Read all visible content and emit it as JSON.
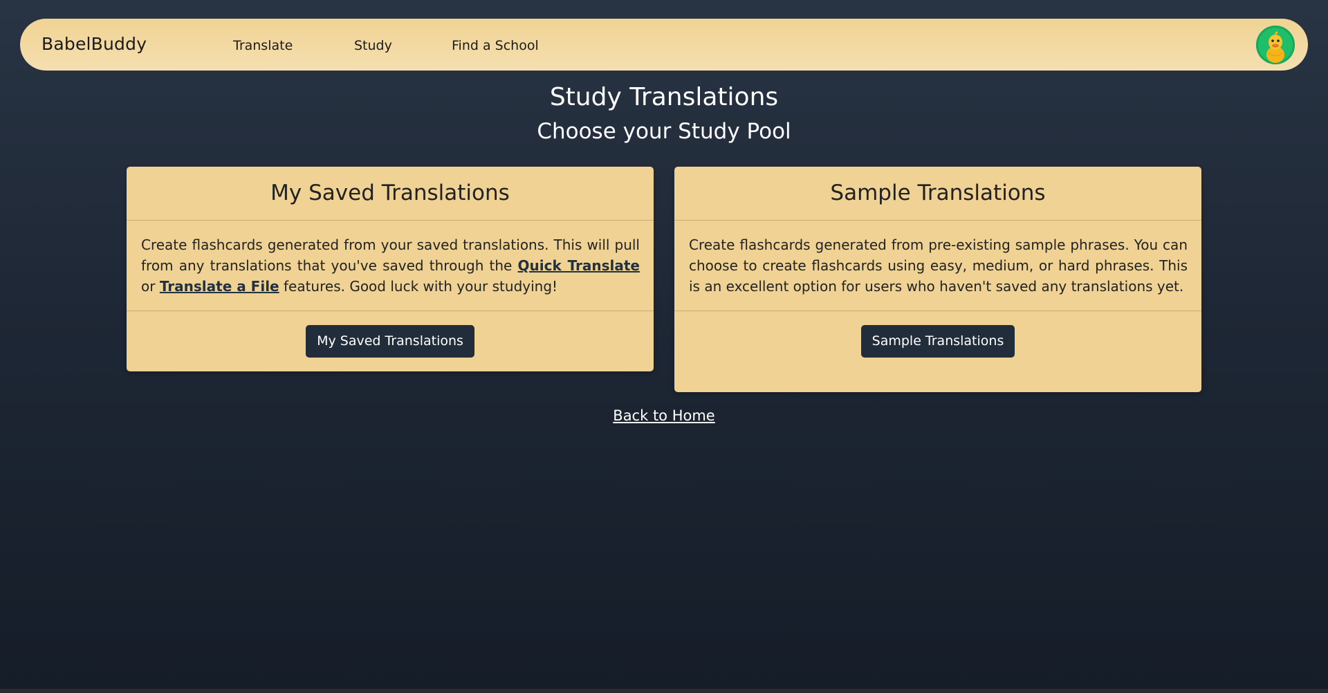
{
  "nav": {
    "brand": "BabelBuddy",
    "links": [
      {
        "label": "Translate"
      },
      {
        "label": "Study"
      },
      {
        "label": "Find a School"
      }
    ],
    "avatar_icon": "duck-avatar-icon"
  },
  "page": {
    "title": "Study Translations",
    "subtitle": "Choose your Study Pool"
  },
  "cards": [
    {
      "header": "My Saved Translations",
      "body_part1": "Create flashcards generated from your saved translations. This will pull from any translations that you've saved through the ",
      "link1": "Quick Translate",
      "body_part2": " or ",
      "link2": "Translate a File",
      "body_part3": " features. Good luck with your studying!",
      "button": "My Saved Translations"
    },
    {
      "header": "Sample Translations",
      "body": "Create flashcards generated from pre-existing sample phrases. You can choose to create flashcards using easy, medium, or hard phrases. This is an excellent option for users who haven't saved any translations yet.",
      "button": "Sample Translations"
    }
  ],
  "footer": {
    "back_link": "Back to Home"
  },
  "colors": {
    "navbar": "#f0d394",
    "card": "#f0d394",
    "button": "#212d3b",
    "background": "#1e2735",
    "avatar": "#1fbf6a"
  }
}
